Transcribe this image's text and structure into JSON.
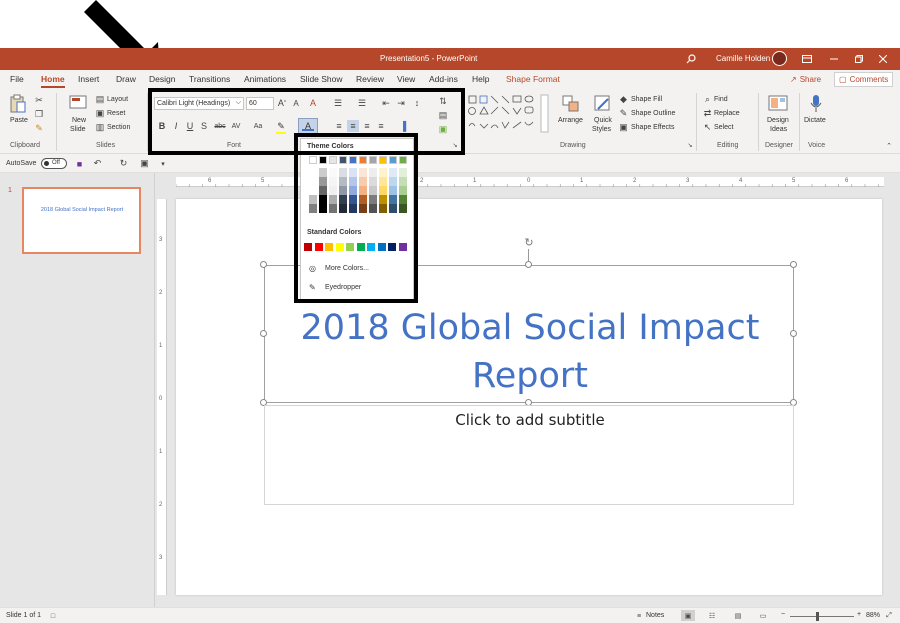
{
  "window": {
    "title": "Presentation5 - PowerPoint",
    "user_name": "Camille Holden"
  },
  "menu": {
    "tabs": [
      "File",
      "Home",
      "Insert",
      "Draw",
      "Design",
      "Transitions",
      "Animations",
      "Slide Show",
      "Review",
      "View",
      "Add-ins",
      "Help",
      "Shape Format"
    ],
    "active_tab": "Home",
    "share_label": "Share",
    "comments_label": "Comments"
  },
  "ribbon": {
    "clipboard": {
      "paste": "Paste",
      "label": "Clipboard"
    },
    "slides": {
      "new_slide_1": "New",
      "new_slide_2": "Slide",
      "layout": "Layout",
      "reset": "Reset",
      "section": "Section",
      "label": "Slides"
    },
    "font": {
      "font_name": "Calibri Light (Headings)",
      "font_size": "60",
      "label": "Font",
      "bold": "B",
      "italic": "I",
      "underline": "U",
      "strike": "S",
      "shadow": "abc",
      "spacing": "AV",
      "case": "Aa"
    },
    "drawing": {
      "arrange": "Arrange",
      "quick_styles_1": "Quick",
      "quick_styles_2": "Styles",
      "shape_fill": "Shape Fill",
      "shape_outline": "Shape Outline",
      "shape_effects": "Shape Effects",
      "label": "Drawing"
    },
    "editing": {
      "find": "Find",
      "replace": "Replace",
      "select": "Select",
      "label": "Editing"
    },
    "designer": {
      "design_ideas_1": "Design",
      "design_ideas_2": "Ideas",
      "label": "Designer"
    },
    "voice": {
      "dictate": "Dictate",
      "label": "Voice"
    }
  },
  "qat": {
    "autosave": "AutoSave",
    "autosave_state": "Off"
  },
  "color_dropdown": {
    "theme_heading": "Theme Colors",
    "standard_heading": "Standard Colors",
    "more_colors": "More Colors...",
    "eyedropper": "Eyedropper",
    "theme_top": [
      "#ffffff",
      "#000000",
      "#e7e6e6",
      "#44546a",
      "#4472c4",
      "#ed7d31",
      "#a5a5a5",
      "#ffc000",
      "#5b9bd5",
      "#70ad47"
    ],
    "standard": [
      "#c00000",
      "#ff0000",
      "#ffc000",
      "#ffff00",
      "#92d050",
      "#00b050",
      "#00b0f0",
      "#0070c0",
      "#002060",
      "#7030a0"
    ]
  },
  "thumbnail": {
    "number": "1",
    "title": "2018 Global Social Impact Report"
  },
  "slide": {
    "title": "2018 Global Social Impact Report",
    "subtitle": "Click to add subtitle"
  },
  "ruler": {
    "h_ticks": [
      "6",
      "5",
      "4",
      "3",
      "2",
      "1",
      "0",
      "1",
      "2",
      "3",
      "4",
      "5",
      "6"
    ],
    "v_ticks": [
      "3",
      "2",
      "1",
      "0",
      "1",
      "2",
      "3"
    ]
  },
  "status": {
    "slide_info": "Slide 1 of 1",
    "notes": "Notes",
    "zoom": "88%"
  },
  "colors": {
    "accent": "#b7472a",
    "title_text": "#4472c4"
  }
}
